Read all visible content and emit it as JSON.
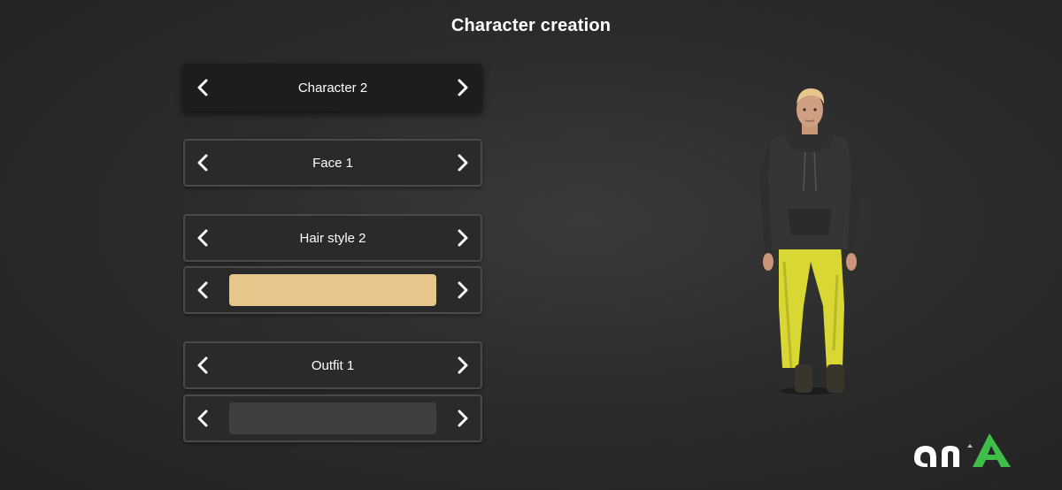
{
  "screen": {
    "title": "Character creation"
  },
  "selectors": {
    "character": {
      "label": "Character 2"
    },
    "face": {
      "label": "Face 1"
    },
    "hair_style": {
      "label": "Hair style 2"
    },
    "hair_color": {
      "color": "#e6c68a"
    },
    "outfit": {
      "label": "Outfit 1"
    },
    "outfit_color": {
      "color": "#3f3f3f"
    }
  },
  "icons": {
    "prev": "chevron-left-icon",
    "next": "chevron-right-icon"
  },
  "colors": {
    "background": "#2c2c2c",
    "panel": "#2a2a2a",
    "active_panel": "#1d1d1d",
    "logo_accent": "#3fbf4a"
  }
}
